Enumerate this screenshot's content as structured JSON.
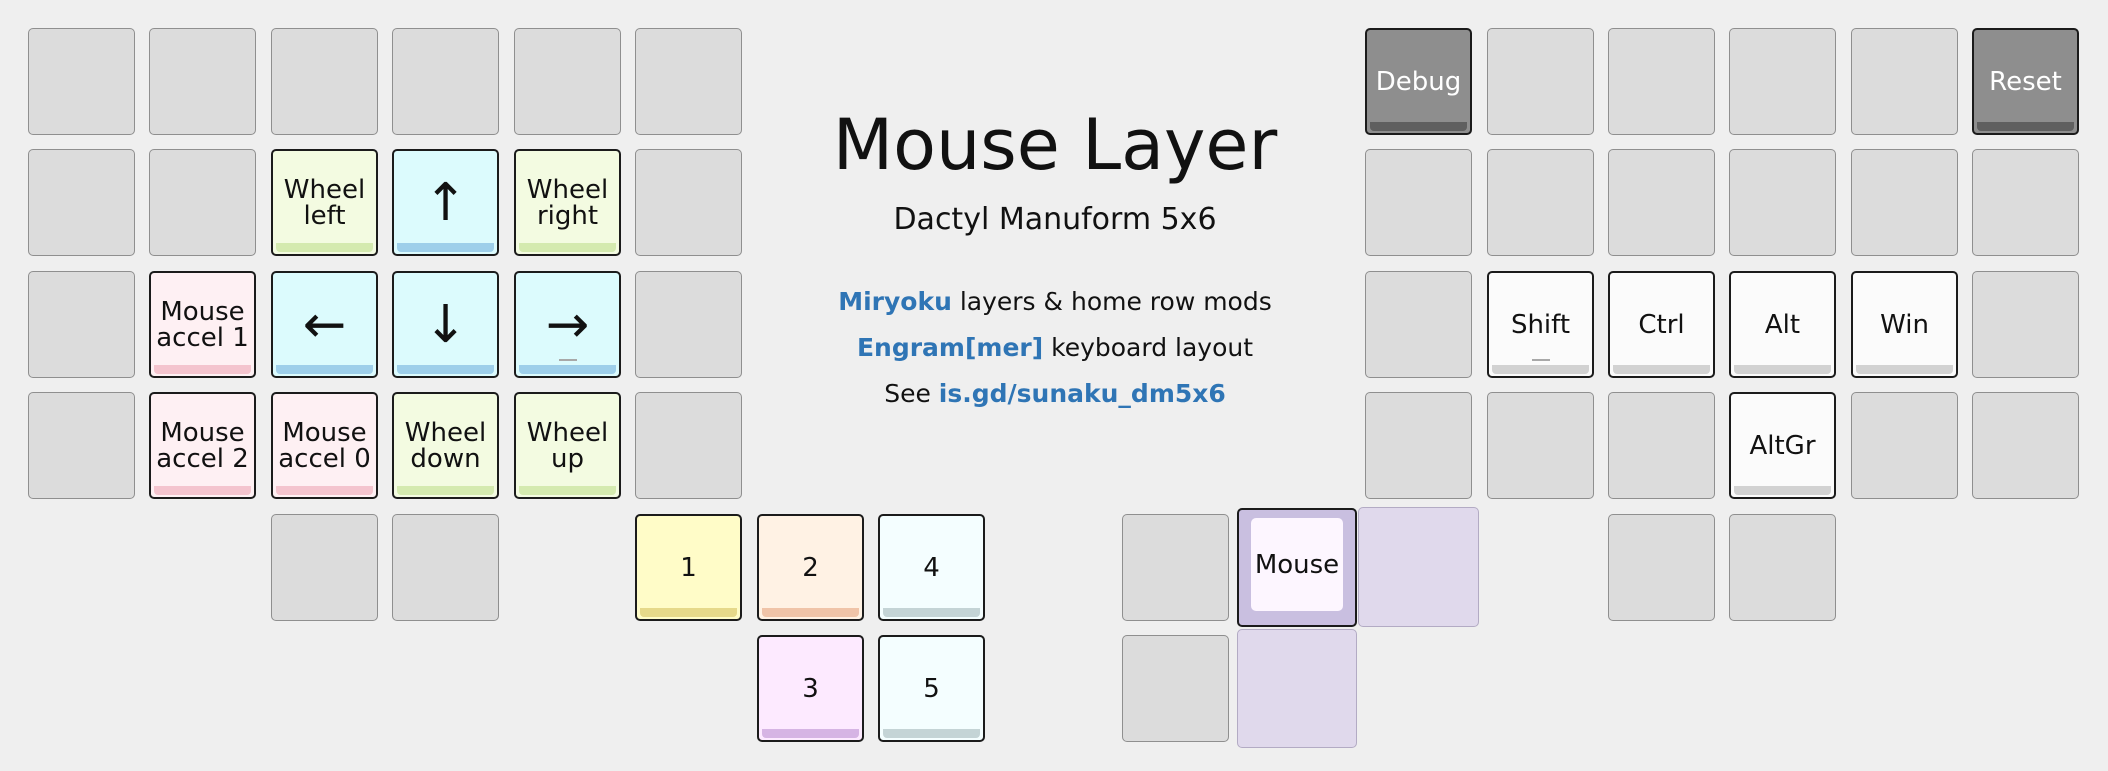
{
  "header": {
    "title": "Mouse Layer",
    "subtitle": "Dactyl Manuform 5x6"
  },
  "info": {
    "line1_link": "Miryoku",
    "line1_text": " layers & home row mods",
    "line2_link": "Engram[mer]",
    "line2_text": " keyboard layout",
    "line3_text": "See ",
    "line3_link": "is.gd/sunaku_dm5x6"
  },
  "colors": {
    "accent": "#2f75b5",
    "wheel": "#f3fbe1",
    "arrow": "#dcfbfd",
    "accel": "#fef0f3",
    "modifier": "#fbfbfb",
    "system": "#8e8e8e",
    "thumb_1": "#fffcc8",
    "thumb_2": "#fff2e4",
    "thumb_3": "#fdeaff",
    "thumb_4_5": "#f4feff",
    "mouse_layer": "#c9bfe0"
  },
  "left_hand": {
    "row2": {
      "wheel_left": "Wheel\nleft",
      "up": "↑",
      "wheel_right": "Wheel\nright"
    },
    "row3": {
      "accel_1": "Mouse\naccel 1",
      "left": "←",
      "down": "↓",
      "right": "→"
    },
    "row4": {
      "accel_2": "Mouse\naccel 2",
      "accel_0": "Mouse\naccel 0",
      "wheel_down": "Wheel\ndown",
      "wheel_up": "Wheel\nup"
    }
  },
  "thumbs_left": {
    "k1": "1",
    "k2": "2",
    "k3": "3",
    "k4": "4",
    "k5": "5"
  },
  "right_hand": {
    "row1": {
      "debug": "Debug",
      "reset": "Reset"
    },
    "row3": {
      "shift": "Shift",
      "ctrl": "Ctrl",
      "alt": "Alt",
      "win": "Win"
    },
    "row4": {
      "altgr": "AltGr"
    }
  },
  "thumbs_right": {
    "mouse": "Mouse"
  }
}
